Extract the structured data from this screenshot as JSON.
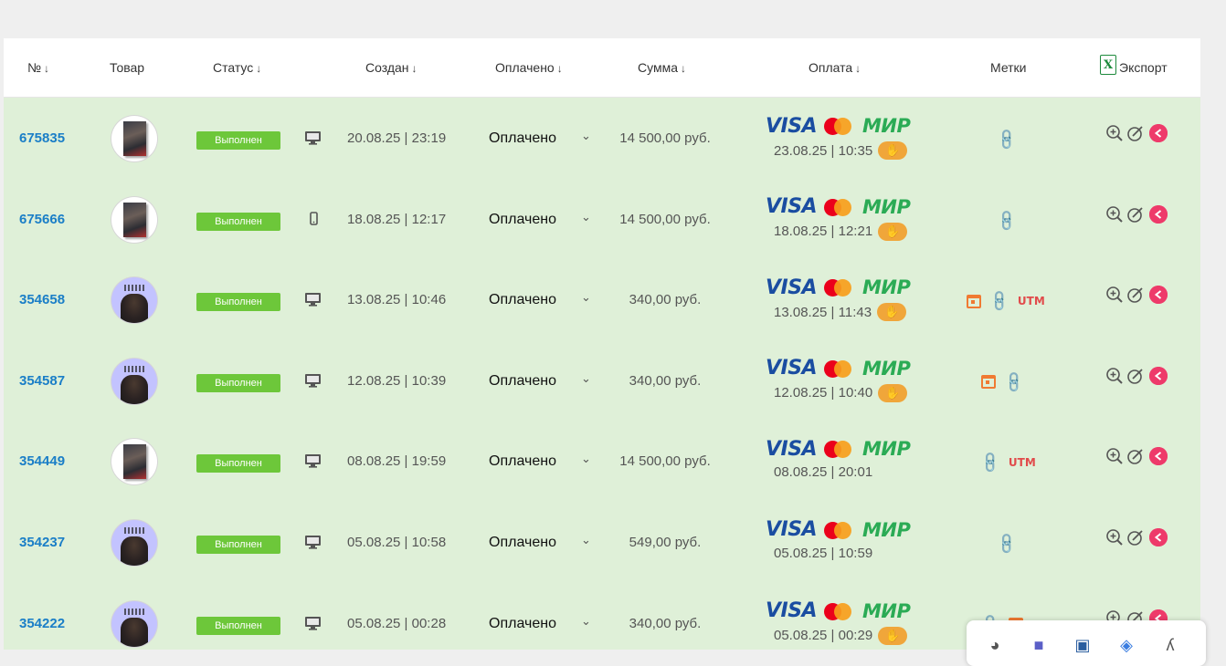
{
  "table": {
    "headers": {
      "num": "№",
      "product": "Товар",
      "status": "Статус",
      "created": "Создан",
      "paid": "Оплачено",
      "sum": "Сумма",
      "payment": "Оплата",
      "tags": "Метки",
      "export": "Экспорт"
    },
    "sort_arrow": "↓",
    "rows": [
      {
        "num": "675835",
        "thumb": "book",
        "status": "Выполнен",
        "device": "desktop",
        "created": "20.08.25 | 23:19",
        "paid": "Оплачено",
        "sum": "14 500,00 руб.",
        "pay_date": "23.08.25 | 10:35",
        "hand": true,
        "tags": [
          "link"
        ]
      },
      {
        "num": "675666",
        "thumb": "book",
        "status": "Выполнен",
        "device": "mobile",
        "created": "18.08.25 | 12:17",
        "paid": "Оплачено",
        "sum": "14 500,00 руб.",
        "pay_date": "18.08.25 | 12:21",
        "hand": true,
        "tags": [
          "link"
        ]
      },
      {
        "num": "354658",
        "thumb": "partner",
        "status": "Выполнен",
        "device": "desktop",
        "created": "13.08.25 | 10:46",
        "paid": "Оплачено",
        "sum": "340,00 руб.",
        "pay_date": "13.08.25 | 11:43",
        "hand": true,
        "tags": [
          "calendar",
          "link",
          "utm"
        ]
      },
      {
        "num": "354587",
        "thumb": "partner",
        "status": "Выполнен",
        "device": "desktop",
        "created": "12.08.25 | 10:39",
        "paid": "Оплачено",
        "sum": "340,00 руб.",
        "pay_date": "12.08.25 | 10:40",
        "hand": true,
        "tags": [
          "calendar",
          "link"
        ]
      },
      {
        "num": "354449",
        "thumb": "book",
        "status": "Выполнен",
        "device": "desktop",
        "created": "08.08.25 | 19:59",
        "paid": "Оплачено",
        "sum": "14 500,00 руб.",
        "pay_date": "08.08.25 | 20:01",
        "hand": false,
        "tags": [
          "link",
          "utm"
        ]
      },
      {
        "num": "354237",
        "thumb": "partner",
        "status": "Выполнен",
        "device": "desktop",
        "created": "05.08.25 | 10:58",
        "paid": "Оплачено",
        "sum": "549,00 руб.",
        "pay_date": "05.08.25 | 10:59",
        "hand": false,
        "tags": [
          "link"
        ]
      },
      {
        "num": "354222",
        "thumb": "partner",
        "status": "Выполнен",
        "device": "desktop",
        "created": "05.08.25 | 00:28",
        "paid": "Оплачено",
        "sum": "340,00 руб.",
        "pay_date": "05.08.25 | 00:29",
        "hand": true,
        "tags": [
          "link",
          "calendar"
        ]
      }
    ]
  },
  "labels": {
    "visa": "VISA",
    "mir": "МИР",
    "utm": "UTM"
  },
  "icons": {
    "desktop": "🖥",
    "mobile": "📱",
    "chevron": "⌄",
    "hand": "✋",
    "link": "🔗",
    "zoom": "⊕",
    "edit": "✎",
    "delete": "←"
  },
  "colors": {
    "row_bg": "#dff0d8",
    "status_bg": "#6dc73a",
    "order_link": "#1a7ec7",
    "delete": "#ee3a6a"
  }
}
